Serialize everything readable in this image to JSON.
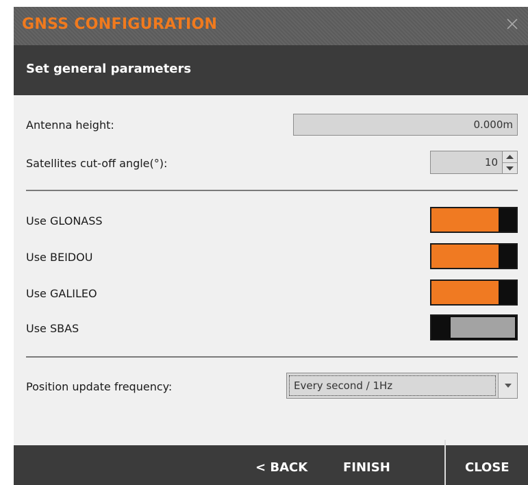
{
  "window": {
    "title": "GNSS CONFIGURATION",
    "close_icon": "close-icon"
  },
  "subheader": {
    "title": "Set general parameters"
  },
  "fields": {
    "antenna_height": {
      "label": "Antenna height:",
      "value": "0.000m"
    },
    "cutoff_angle": {
      "label": "Satellites cut-off angle(°):",
      "value": "10"
    }
  },
  "toggles": [
    {
      "label": "Use GLONASS",
      "state": "on"
    },
    {
      "label": "Use BEIDOU",
      "state": "on"
    },
    {
      "label": "Use GALILEO",
      "state": "on"
    },
    {
      "label": "Use SBAS",
      "state": "off"
    }
  ],
  "update_frequency": {
    "label": "Position update frequency:",
    "selected": "Every second / 1Hz"
  },
  "footer": {
    "back_label": "< BACK",
    "finish_label": "FINISH",
    "close_label": "CLOSE"
  },
  "colors": {
    "accent": "#f07a22",
    "header_bg": "#3b3b3b",
    "title_bg": "#5e5e5e",
    "toggle_off": "#a3a3a3"
  }
}
